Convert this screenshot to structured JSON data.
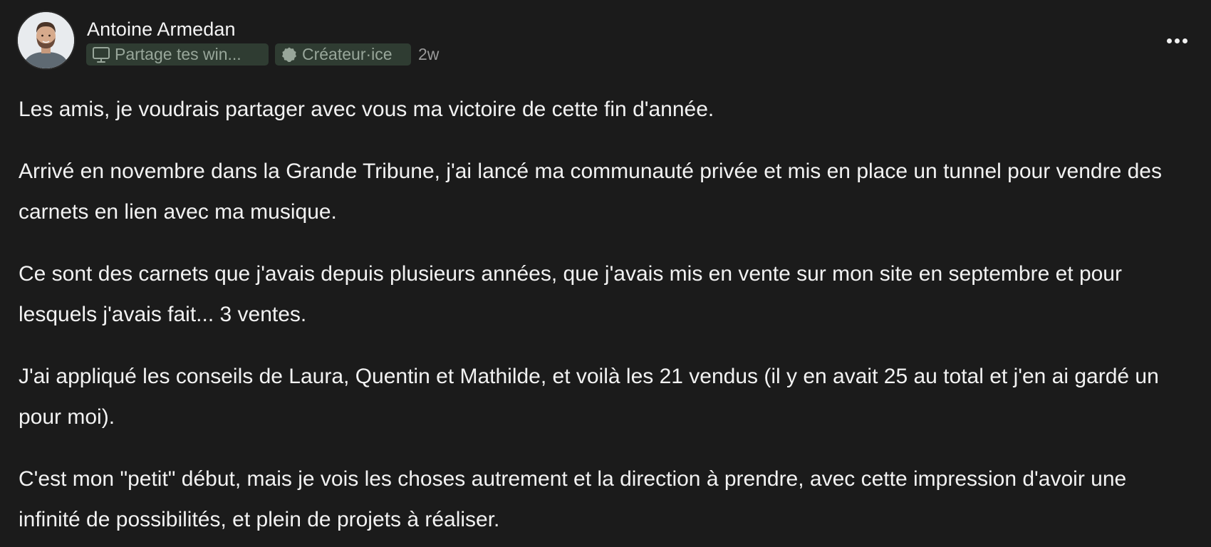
{
  "post": {
    "author": {
      "name": "Antoine Armedan",
      "avatar_icon": "person-avatar"
    },
    "channel_badge": {
      "icon": "monitor-icon",
      "label": "Partage tes win..."
    },
    "role_badge": {
      "icon": "badge-seal-icon",
      "label": "Créateur·ice"
    },
    "timestamp": "2w",
    "more_icon": "more-horizontal-icon",
    "paragraphs": [
      "Les amis, je voudrais partager avec vous ma victoire de cette fin d'année.",
      "Arrivé en novembre dans la Grande Tribune, j'ai lancé ma communauté privée et mis en place un tunnel pour vendre des carnets en lien avec ma musique.",
      "Ce sont des carnets que j'avais depuis plusieurs années, que j'avais mis en vente sur mon site en septembre et pour lesquels j'avais fait... 3 ventes.",
      "J'ai appliqué les conseils de Laura, Quentin et Mathilde, et voilà les 21 vendus (il y en avait 25 au total et j'en ai gardé un pour moi).",
      "C'est mon \"petit\" début, mais je vois les choses autrement et la direction à prendre, avec cette impression d'avoir une infinité de possibilités, et plein de projets à réaliser."
    ]
  },
  "colors": {
    "background": "#1b1b1b",
    "text": "#f2f2f2",
    "badge_bg": "#2f3c32",
    "badge_text": "#98a69a",
    "muted": "#9a9a9a"
  }
}
